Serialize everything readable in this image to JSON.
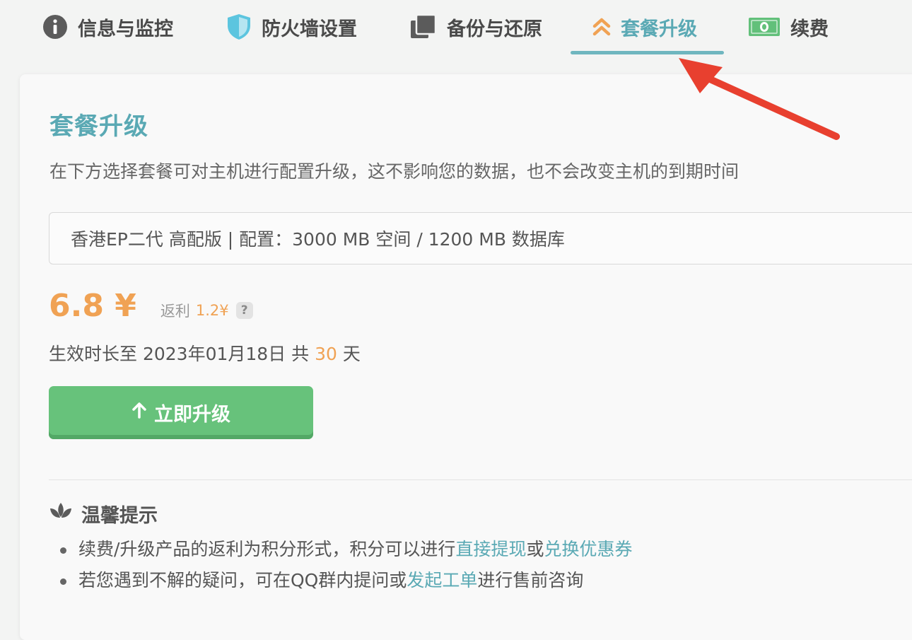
{
  "tabs": [
    {
      "label": "信息与监控",
      "icon": "info-icon"
    },
    {
      "label": "防火墙设置",
      "icon": "shield-icon"
    },
    {
      "label": "备份与还原",
      "icon": "copy-icon"
    },
    {
      "label": "套餐升级",
      "icon": "double-chevron-up-icon",
      "active": true
    },
    {
      "label": "续费",
      "icon": "money-icon"
    }
  ],
  "upgrade": {
    "title": "套餐升级",
    "description": "在下方选择套餐可对主机进行配置升级，这不影响您的数据，也不会改变主机的到期时间",
    "selected_plan": "香港EP二代 高配版 | 配置：3000 MB 空间 / 1200 MB 数据库",
    "price": "6.8 ¥",
    "rebate_label": "返利",
    "rebate_amount": "1.2¥",
    "help_glyph": "?",
    "validity_prefix": "生效时长至 2023年01月18日 共 ",
    "validity_days": "30",
    "validity_suffix": " 天",
    "button_label": "立即升级"
  },
  "tips": {
    "title": "温馨提示",
    "item1_text": "续费/升级产品的返利为积分形式，积分可以进行",
    "item1_link1": "直接提现",
    "item1_mid": "或",
    "item1_link2": "兑换优惠券",
    "item2_text": "若您遇到不解的疑问，可在QQ群内提问或",
    "item2_link": "发起工单",
    "item2_suffix": "进行售前咨询"
  },
  "colors": {
    "accent": "#5aa9b4",
    "price": "#f0a254",
    "button": "#67c27b",
    "annotation_arrow": "#e8402f"
  }
}
